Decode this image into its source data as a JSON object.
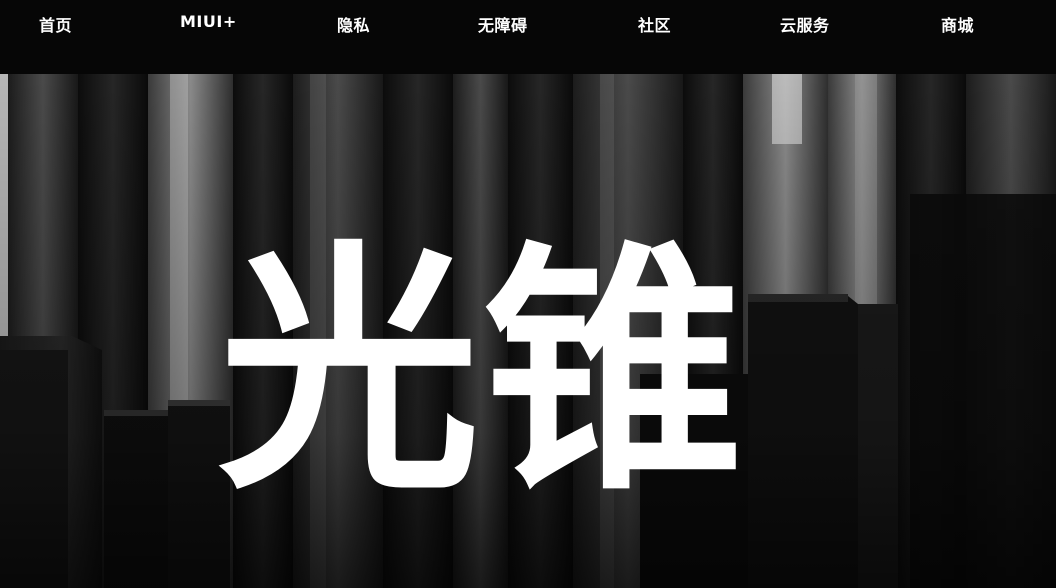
{
  "nav": {
    "items": [
      {
        "label": "首页"
      },
      {
        "label": "MIUI+"
      },
      {
        "label": "隐私"
      },
      {
        "label": "无障碍"
      },
      {
        "label": "社区"
      },
      {
        "label": "云服务"
      },
      {
        "label": "商城"
      }
    ]
  },
  "hero": {
    "title": "光锥"
  },
  "colors": {
    "background": "#000000",
    "nav_text": "#ffffff",
    "hero_text": "#ffffff"
  }
}
